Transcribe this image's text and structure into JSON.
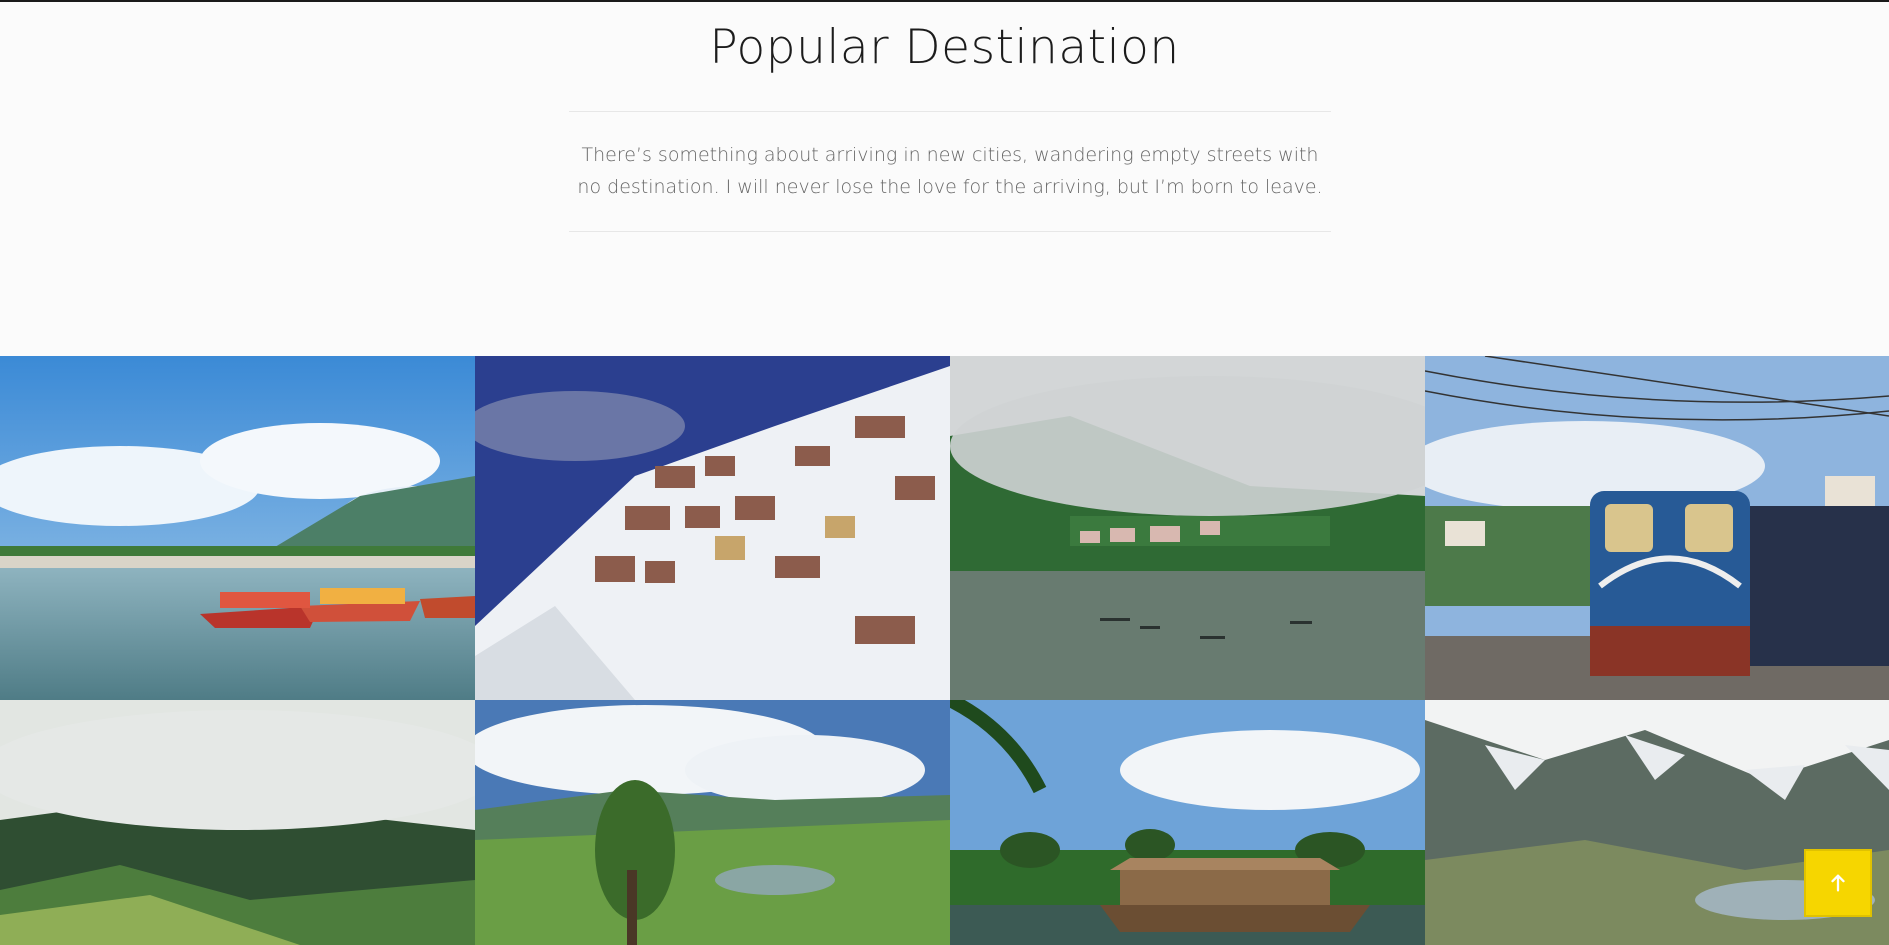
{
  "section": {
    "title": "Popular Destination",
    "description": "There’s something about arriving in new cities, wandering empty streets with no destination. I will never lose the love for the arriving, but I’m born to leave."
  },
  "gallery": {
    "items": [
      {
        "scene": "lake-shikaras-mountains"
      },
      {
        "scene": "snowy-hillside-town"
      },
      {
        "scene": "misty-lake-boats"
      },
      {
        "scene": "blue-toy-train-station"
      },
      {
        "scene": "cloudy-green-hills"
      },
      {
        "scene": "tea-valley-lake"
      },
      {
        "scene": "backwater-houseboat-palms"
      },
      {
        "scene": "snowy-mountain-valley"
      }
    ]
  },
  "scroll_top": {
    "icon": "arrow-up-icon"
  },
  "colors": {
    "accent_button": "#f6d600",
    "title_text": "#1c1c1c",
    "body_text": "#666666"
  }
}
